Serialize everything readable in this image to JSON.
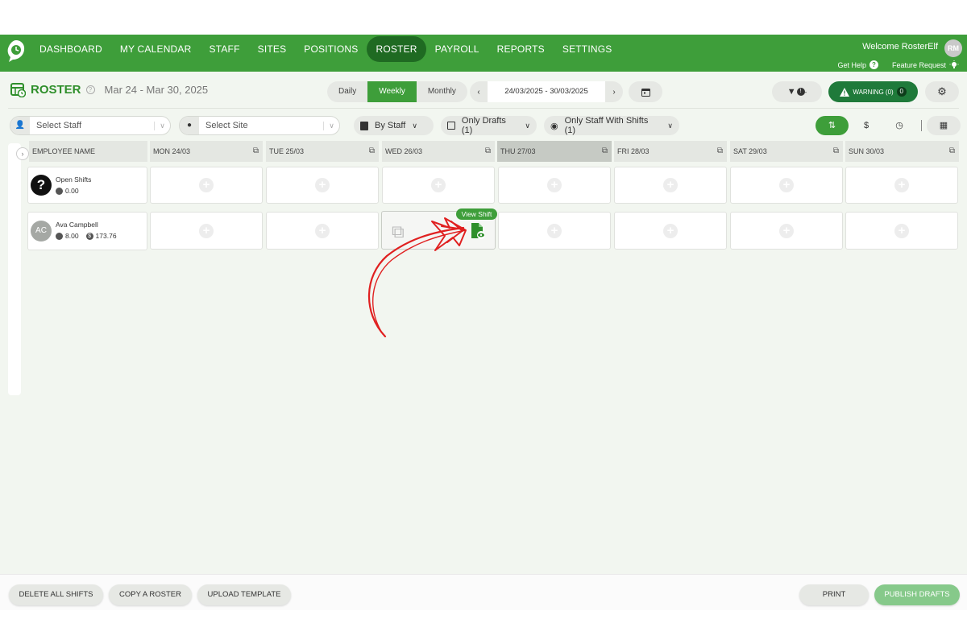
{
  "nav": {
    "items": [
      "DASHBOARD",
      "MY CALENDAR",
      "STAFF",
      "SITES",
      "POSITIONS",
      "ROSTER",
      "PAYROLL",
      "REPORTS",
      "SETTINGS"
    ],
    "active": "ROSTER",
    "welcome": "Welcome RosterElf",
    "avatar": "RM",
    "help": "Get Help",
    "feature": "Feature Request"
  },
  "header": {
    "title": "ROSTER",
    "range": "Mar 24 - Mar 30, 2025",
    "views": [
      "Daily",
      "Weekly",
      "Monthly"
    ],
    "active_view": "Weekly",
    "date_value": "24/03/2025 - 30/03/2025",
    "warning": "WARNING (0)",
    "warning_count": "0"
  },
  "filters": {
    "staff_placeholder": "Select Staff",
    "site_placeholder": "Select Site",
    "group_by": "By Staff",
    "drafts": "Only Drafts (1)",
    "staff_with_shifts": "Only Staff With Shifts (1)"
  },
  "grid": {
    "employee_header": "EMPLOYEE NAME",
    "days": [
      "MON 24/03",
      "TUE 25/03",
      "WED 26/03",
      "THU 27/03",
      "FRI 28/03",
      "SAT 29/03",
      "SUN 30/03"
    ],
    "today": "THU 27/03",
    "rows": [
      {
        "name": "Open Shifts",
        "hours": "0.00"
      },
      {
        "name": "Ava Campbell",
        "initials": "AC",
        "hours": "8.00",
        "cost": "173.76"
      }
    ],
    "tooltip": "View Shift"
  },
  "footer": {
    "delete": "DELETE ALL SHIFTS",
    "copy": "COPY A ROSTER",
    "upload": "UPLOAD TEMPLATE",
    "print": "PRINT",
    "publish": "PUBLISH DRAFTS"
  },
  "colors": {
    "brand": "#3e9e3a",
    "nav_active": "#1f6a22",
    "annotation": "#e02020"
  }
}
